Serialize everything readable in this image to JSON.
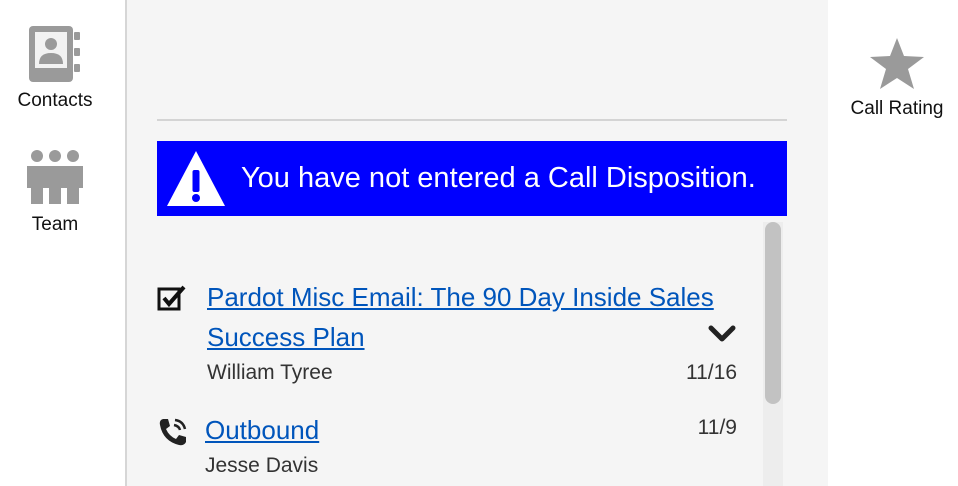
{
  "left_rail": {
    "contacts_label": "Contacts",
    "team_label": "Team"
  },
  "alert": {
    "message": "You have not entered a Call Disposition.",
    "icon": "warning-triangle-icon",
    "background": "#0000ff"
  },
  "activities": [
    {
      "type_icon": "task-checkbox-icon",
      "title_line1": "Pardot Misc Email: The 90 Day Inside Sales",
      "title_line2": "Success Plan",
      "person": "William Tyree",
      "date": "11/16",
      "expand_icon": "chevron-down-icon"
    },
    {
      "type_icon": "phone-call-icon",
      "title": "Outbound",
      "person": "Jesse Davis",
      "date": "11/9"
    }
  ],
  "right_rail": {
    "call_rating_label": "Call Rating",
    "icon": "star-icon"
  },
  "colors": {
    "link": "#0055bb",
    "icon_gray": "#9a9a9a"
  }
}
